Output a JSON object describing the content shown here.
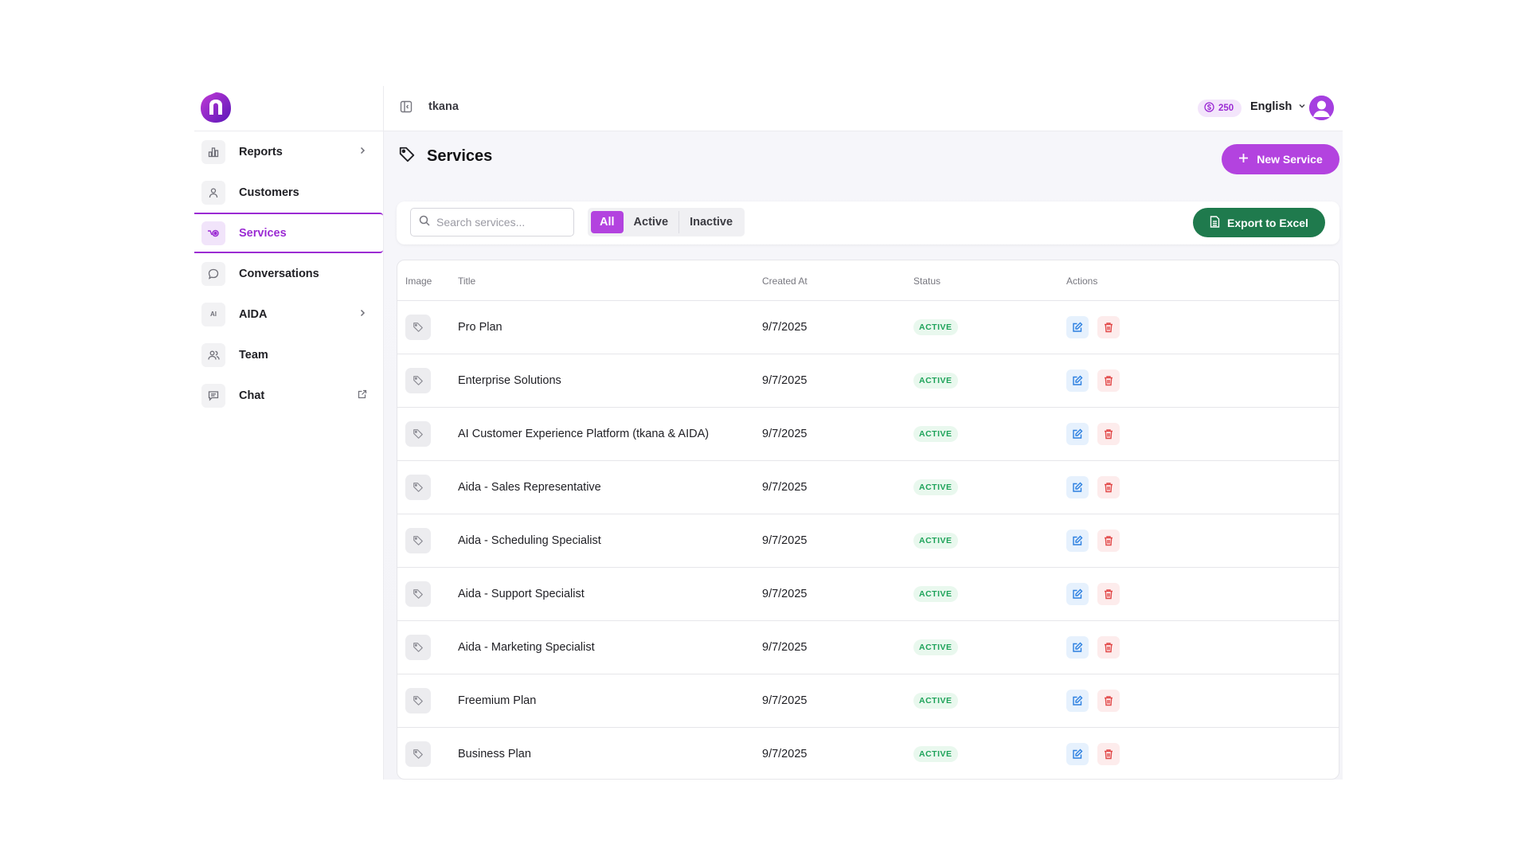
{
  "app": {
    "org_name": "tkana"
  },
  "colors": {
    "brand": "#9b2bd3",
    "primary_button": "#b343df",
    "export_button": "#1f7a4d",
    "status_active": "#1ea35a"
  },
  "sidebar": {
    "items": [
      {
        "label": "Reports",
        "icon": "bar-chart-icon",
        "trail": "chevron-right-icon"
      },
      {
        "label": "Customers",
        "icon": "user-icon"
      },
      {
        "label": "Services",
        "icon": "services-icon",
        "active": true
      },
      {
        "label": "Conversations",
        "icon": "chat-bubble-icon"
      },
      {
        "label": "AIDA",
        "icon": "ai-icon",
        "icon_text": "AI",
        "trail": "chevron-right-icon"
      },
      {
        "label": "Team",
        "icon": "users-icon"
      },
      {
        "label": "Chat",
        "icon": "message-square-icon",
        "trail": "external-link-icon"
      }
    ]
  },
  "header": {
    "credits": "250",
    "language": "English"
  },
  "page": {
    "title": "Services",
    "new_button": "New Service",
    "search_placeholder": "Search services...",
    "filters": [
      "All",
      "Active",
      "Inactive"
    ],
    "active_filter": "All",
    "export_button": "Export to Excel"
  },
  "table": {
    "columns": [
      "Image",
      "Title",
      "Created At",
      "Status",
      "Actions"
    ],
    "rows": [
      {
        "title": "Pro Plan",
        "created_at": "9/7/2025",
        "status": "ACTIVE"
      },
      {
        "title": "Enterprise Solutions",
        "created_at": "9/7/2025",
        "status": "ACTIVE"
      },
      {
        "title": "AI Customer Experience Platform (tkana & AIDA)",
        "created_at": "9/7/2025",
        "status": "ACTIVE"
      },
      {
        "title": "Aida - Sales Representative",
        "created_at": "9/7/2025",
        "status": "ACTIVE"
      },
      {
        "title": "Aida - Scheduling Specialist",
        "created_at": "9/7/2025",
        "status": "ACTIVE"
      },
      {
        "title": "Aida - Support Specialist",
        "created_at": "9/7/2025",
        "status": "ACTIVE"
      },
      {
        "title": "Aida - Marketing Specialist",
        "created_at": "9/7/2025",
        "status": "ACTIVE"
      },
      {
        "title": "Freemium Plan",
        "created_at": "9/7/2025",
        "status": "ACTIVE"
      },
      {
        "title": "Business Plan",
        "created_at": "9/7/2025",
        "status": "ACTIVE"
      }
    ]
  }
}
